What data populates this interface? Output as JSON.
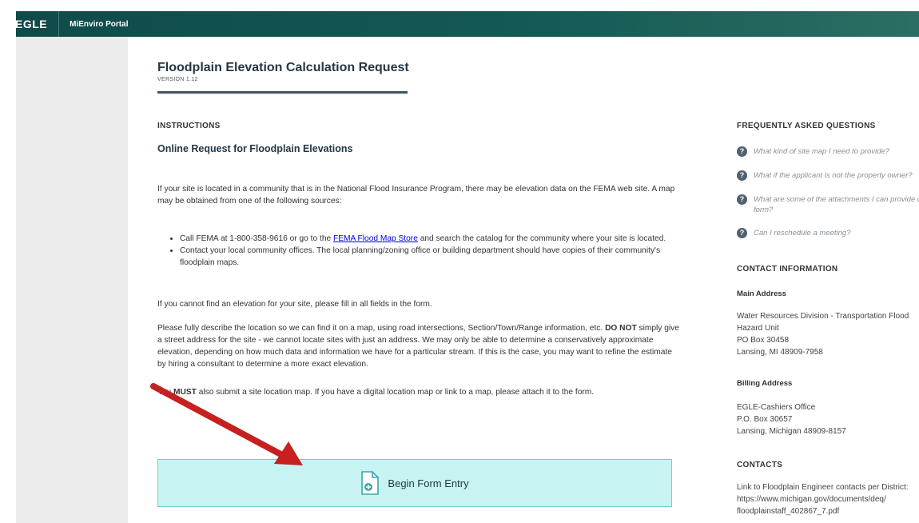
{
  "header": {
    "logo": "EGLE",
    "portal": "MiEnviro Portal"
  },
  "page": {
    "title": "Floodplain Elevation Calculation Request",
    "version": "VERSION 1.12",
    "instructions_heading": "INSTRUCTIONS",
    "subheading": "Online Request for Floodplain Elevations",
    "intro": "If your site is located in a community that is in the National Flood Insurance Program, there may be elevation data on the FEMA web site. A map may be obtained from one of the following sources:",
    "bullet1_pre": "Call FEMA at 1-800-358-9616 or go to the ",
    "bullet1_link": "FEMA Flood Map Store",
    "bullet1_post": " and search the catalog for the community where your site is located.",
    "bullet2": "Contact your local community offices.  The local planning/zoning office or building department should have copies of their community's floodplain maps.",
    "para_find": "If you cannot find an elevation for your site, please fill in all fields in the form.",
    "para_describe_pre": "Please fully describe the location so we can find it on a map, using road intersections, Section/Town/Range information, etc. ",
    "para_describe_bold": "DO NOT",
    "para_describe_post": " simply give a street address for the site - we cannot locate sites with just an address.  We may only be able to determine a conservatively approximate elevation, depending on how much data and information we have for a particular stream. If this is the case, you may want to refine the estimate by hiring a consultant to determine a more exact elevation.",
    "para_must_pre": "You ",
    "para_must_bold": "MUST",
    "para_must_post": " also submit a site location map. If you have a digital location map or link to a map, please attach it to the form.",
    "begin_button": "Begin Form Entry"
  },
  "sidebar": {
    "faq_heading": "FREQUENTLY ASKED QUESTIONS",
    "faq": [
      "What kind of site map I need to provide?",
      "What if the applicant is not the property owner?",
      "What are some of the attachments I can provide on the",
      "form?",
      "Can I reschedule a meeting?"
    ],
    "contact_heading": "CONTACT INFORMATION",
    "main_address_label": "Main Address",
    "main_address": [
      "Water Resources Division - Transportation Flood",
      "Hazard Unit",
      "PO Box 30458",
      "Lansing, MI 48909-7958"
    ],
    "billing_label": "Billing Address",
    "billing_address": [
      "EGLE-Cashiers Office",
      "P.O. Box 30657",
      "Lansing, Michigan 48909-8157"
    ],
    "contacts_heading": "CONTACTS",
    "contacts": [
      "Link to Floodplain Engineer contacts per District:",
      "https://www.michigan.gov/documents/deq/",
      "floodplainstaff_402867_7.pdf"
    ]
  },
  "colors": {
    "topbar": "#155a55",
    "button_bg": "#c7f3f3",
    "button_border": "#6fd0d2",
    "arrow": "#c62020"
  }
}
